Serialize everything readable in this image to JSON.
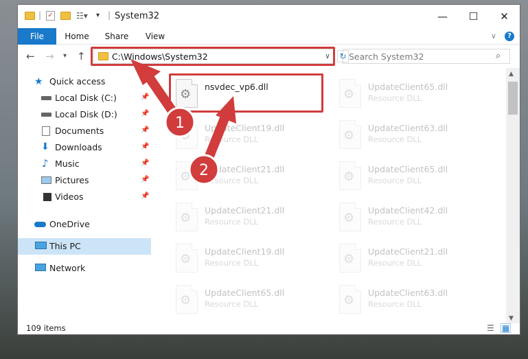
{
  "window": {
    "title": "System32",
    "controls": {
      "minimize": "—",
      "maximize": "☐",
      "close": "✕"
    }
  },
  "ribbon": {
    "tabs": [
      "File",
      "Home",
      "Share",
      "View"
    ]
  },
  "address": {
    "path": "C:\\Windows\\System32",
    "search_placeholder": "Search System32"
  },
  "sidebar": {
    "quick_access": "Quick access",
    "items": [
      "Local Disk (C:)",
      "Local Disk (D:)",
      "Documents",
      "Downloads",
      "Music",
      "Pictures",
      "Videos"
    ],
    "onedrive": "OneDrive",
    "this_pc": "This PC",
    "network": "Network"
  },
  "files": {
    "highlighted": {
      "name": "nsvdec_vp6.dll",
      "type": ""
    },
    "col1": [
      {
        "name": "UpdateClient19.dll",
        "type": "Resource DLL"
      },
      {
        "name": "UpdateClient21.dll",
        "type": "Resource DLL"
      },
      {
        "name": "UpdateClient21.dll",
        "type": "Resource DLL"
      },
      {
        "name": "UpdateClient19.dll",
        "type": "Resource DLL"
      },
      {
        "name": "UpdateClient65.dll",
        "type": "Resource DLL"
      }
    ],
    "col2": [
      {
        "name": "UpdateClient65.dll",
        "type": "Resource DLL"
      },
      {
        "name": "UpdateClient63.dll",
        "type": "Resource DLL"
      },
      {
        "name": "UpdateClient65.dll",
        "type": "Resource DLL"
      },
      {
        "name": "UpdateClient42.dll",
        "type": "Resource DLL"
      },
      {
        "name": "UpdateClient21.dll",
        "type": "Resource DLL"
      },
      {
        "name": "UpdateClient63.dll",
        "type": "Resource DLL"
      }
    ]
  },
  "status": {
    "items": "109 items"
  },
  "annotations": {
    "step1": "1",
    "step2": "2"
  },
  "colors": {
    "accent": "#1979ca",
    "highlight": "#d13c3c",
    "selected": "#cce4f7"
  }
}
